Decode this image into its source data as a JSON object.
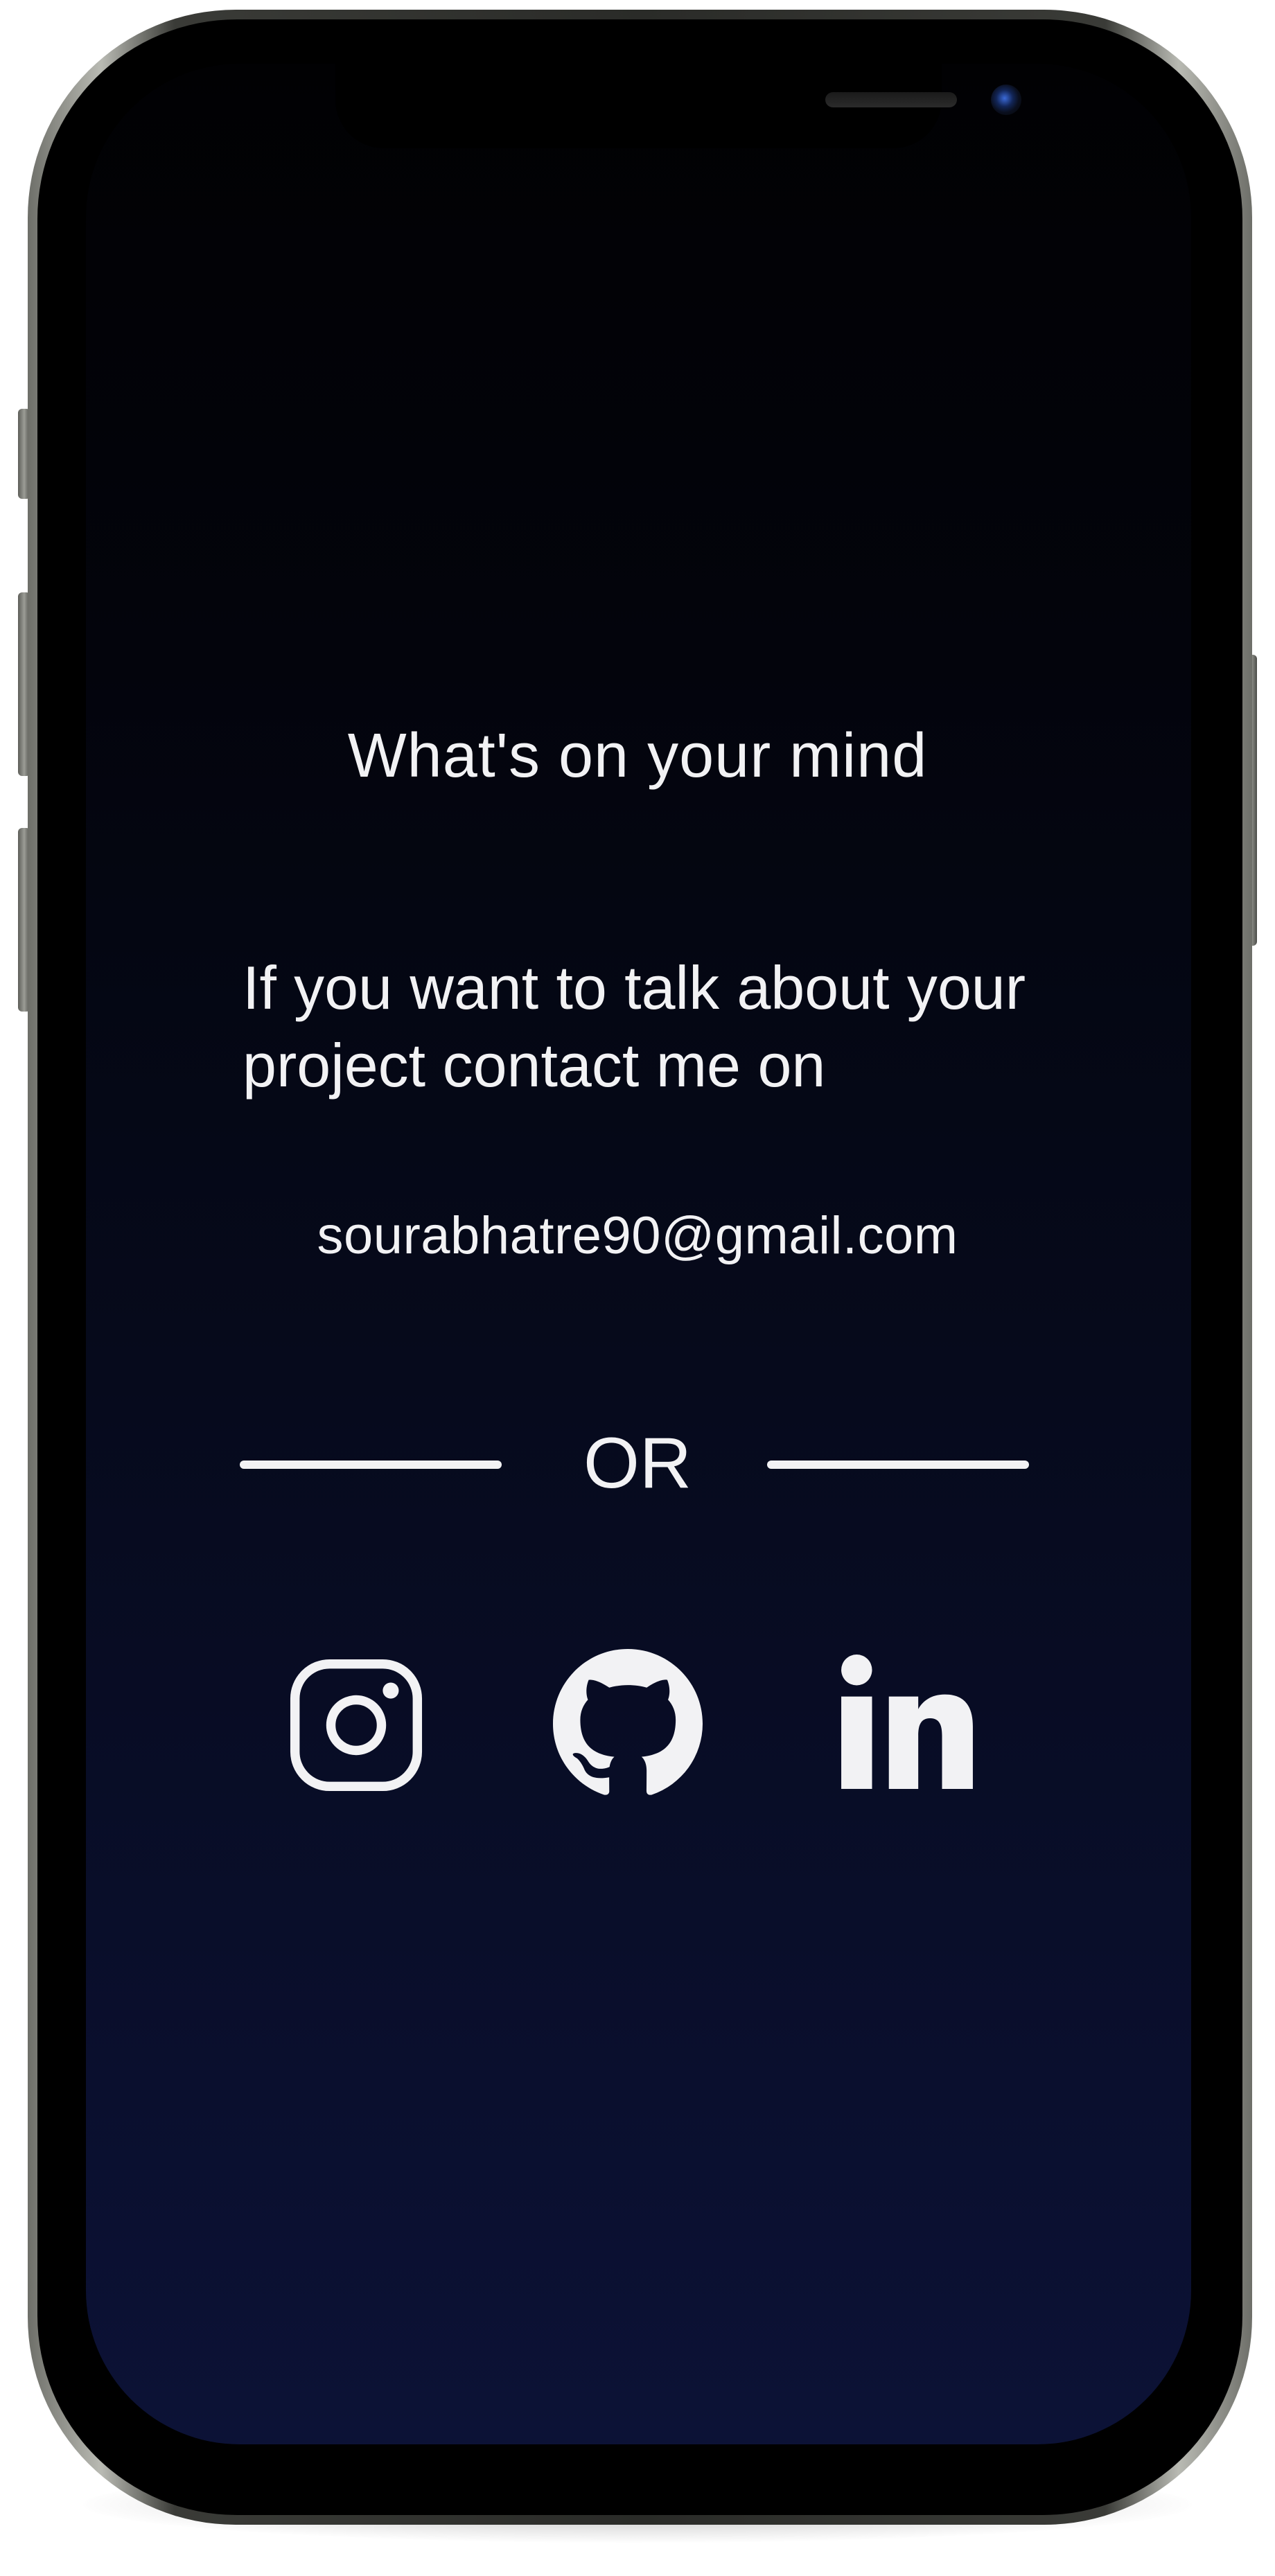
{
  "contact": {
    "heading": "What's on your mind",
    "message": "If you want to talk about your project contact me on",
    "email": "sourabhatre90@gmail.com",
    "separator": "OR"
  },
  "social": [
    {
      "name": "Instagram",
      "icon": "instagram-icon"
    },
    {
      "name": "GitHub",
      "icon": "github-icon"
    },
    {
      "name": "LinkedIn",
      "icon": "linkedin-icon"
    }
  ],
  "colors": {
    "text": "#f2f2f4",
    "screen_top": "#010103",
    "screen_bottom": "#0c1236",
    "frame": "#000000"
  }
}
